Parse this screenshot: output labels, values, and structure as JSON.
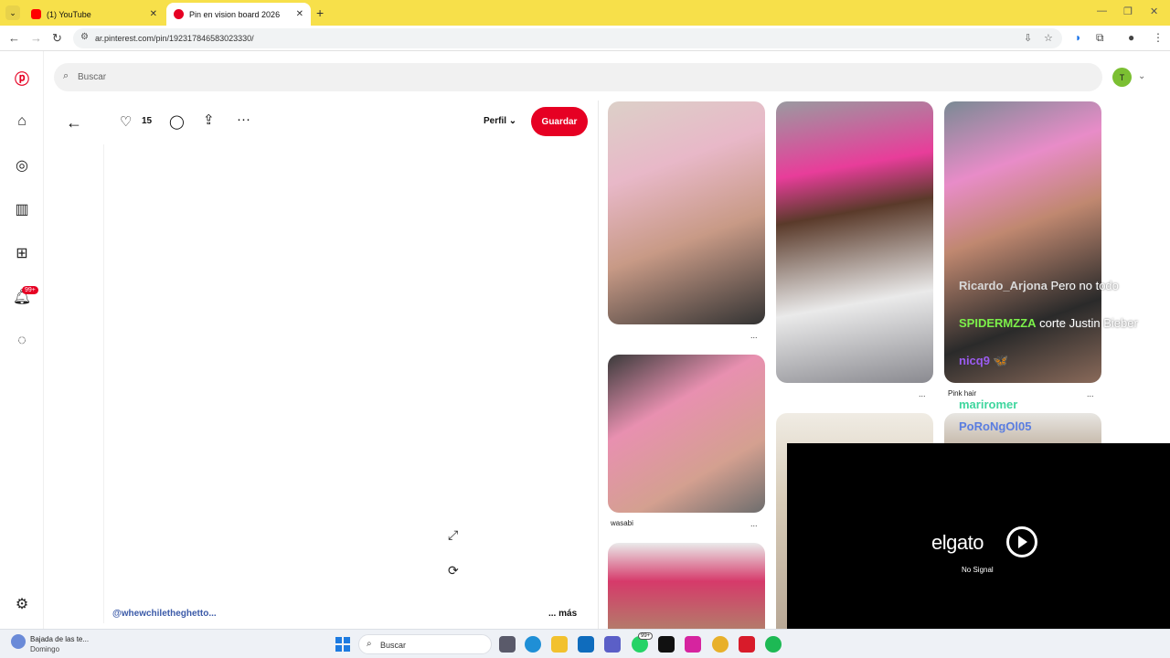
{
  "browser": {
    "tabs": [
      {
        "label": "(1) YouTube"
      },
      {
        "label": "Pin en vision board 2026"
      }
    ],
    "new_tab": "+",
    "url": "ar.pinterest.com/pin/192317846583023330/"
  },
  "search": {
    "placeholder": "Buscar"
  },
  "user": {
    "avatar_letter": "T"
  },
  "sidebar": {
    "notifications_badge": "99+"
  },
  "pin": {
    "likes": "15",
    "profile_label": "Perfil",
    "save_label": "Guardar",
    "author": "@whewchiletheghetto...",
    "more_label": "... más"
  },
  "grid": {
    "labels": [
      "wasabi",
      "Pink hair"
    ],
    "more": "..."
  },
  "chat": [
    {
      "user": "Ricardo_Arjona",
      "color": "#d8d8d8",
      "msg": "Pero no todo"
    },
    {
      "user": "SPIDERMZZA",
      "color": "#7cf04a",
      "msg": "corte Justin Bieber"
    },
    {
      "user": "nicq9",
      "color": "#9b5cf0",
      "msg": "🦋"
    },
    {
      "user": "mariromer",
      "color": "#3fd69e",
      "msg": ""
    },
    {
      "user": "PoRoNgOl05",
      "color": "#5a7de0",
      "msg": ""
    }
  ],
  "elgato": {
    "brand": "elgato",
    "status": "No Signal"
  },
  "taskbar": {
    "news_title": "Bajada de las te...",
    "news_sub": "Domingo",
    "search_label": "Buscar",
    "teams_badge": "99+"
  }
}
